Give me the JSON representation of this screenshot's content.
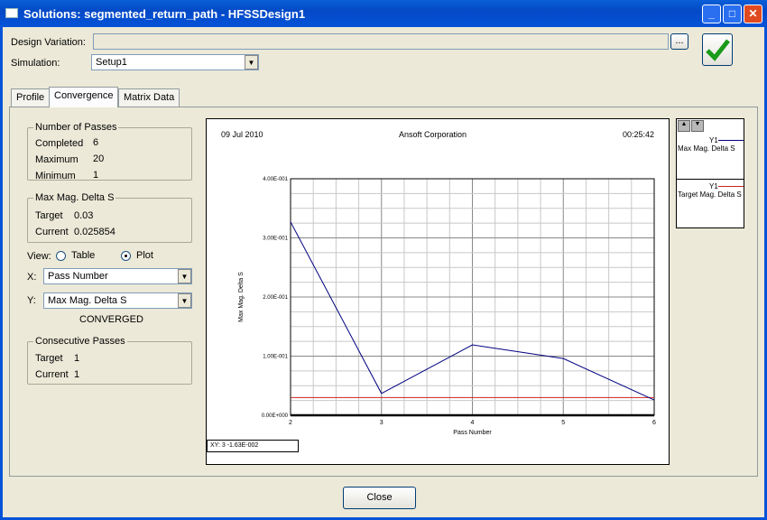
{
  "window": {
    "title": "Solutions: segmented_return_path - HFSSDesign1"
  },
  "form": {
    "design_variation_label": "Design Variation:",
    "design_variation_value": "",
    "browse_label": "...",
    "simulation_label": "Simulation:",
    "simulation_value": "Setup1"
  },
  "tabs": [
    {
      "label": "Profile"
    },
    {
      "label": "Convergence"
    },
    {
      "label": "Matrix Data"
    }
  ],
  "passes": {
    "title": "Number of Passes",
    "completed_label": "Completed",
    "completed": "6",
    "maximum_label": "Maximum",
    "maximum": "20",
    "minimum_label": "Minimum",
    "minimum": "1"
  },
  "delta": {
    "title": "Max Mag. Delta S",
    "target_label": "Target",
    "target": "0.03",
    "current_label": "Current",
    "current": "0.025854"
  },
  "view": {
    "label": "View:",
    "table": "Table",
    "plot": "Plot",
    "selected": "Plot"
  },
  "axes": {
    "x_label": "X:",
    "x_value": "Pass Number",
    "y_label": "Y:",
    "y_value": "Max Mag. Delta S"
  },
  "status": "CONVERGED",
  "consecutive": {
    "title": "Consecutive Passes",
    "target_label": "Target",
    "target": "1",
    "current_label": "Current",
    "current": "1"
  },
  "plot_header": {
    "date": "09 Jul 2010",
    "company": "Ansoft Corporation",
    "time": "00:25:42"
  },
  "xy_readout": "XY:  3 -1.63E-002",
  "legend": [
    {
      "tag": "Y1",
      "name": "Max Mag. Delta S",
      "color": "#000080"
    },
    {
      "tag": "Y1",
      "name": "Target Mag. Delta S",
      "color": "#cc2222"
    }
  ],
  "close_label": "Close",
  "chart_data": {
    "type": "line",
    "title": "",
    "xlabel": "Pass Number",
    "ylabel": "Max Mag. Delta S",
    "x": [
      2,
      3,
      4,
      5,
      6
    ],
    "xlim": [
      2,
      6
    ],
    "ylim": [
      0,
      0.4
    ],
    "xticks": [
      "2",
      "3",
      "4",
      "5",
      "6"
    ],
    "yticks": [
      {
        "v": 0,
        "label": "0.00E+000"
      },
      {
        "v": 0.1,
        "label": "1.00E-001"
      },
      {
        "v": 0.2,
        "label": "2.00E-001"
      },
      {
        "v": 0.3,
        "label": "3.00E-001"
      },
      {
        "v": 0.4,
        "label": "4.00E-001"
      }
    ],
    "series": [
      {
        "name": "Max Mag. Delta S",
        "values": [
          0.327,
          0.037,
          0.119,
          0.096,
          0.0259
        ],
        "color": "#000080"
      },
      {
        "name": "Target Mag. Delta S",
        "values": [
          0.03,
          0.03,
          0.03,
          0.03,
          0.03
        ],
        "color": "#cc2222"
      }
    ],
    "grid": true
  }
}
